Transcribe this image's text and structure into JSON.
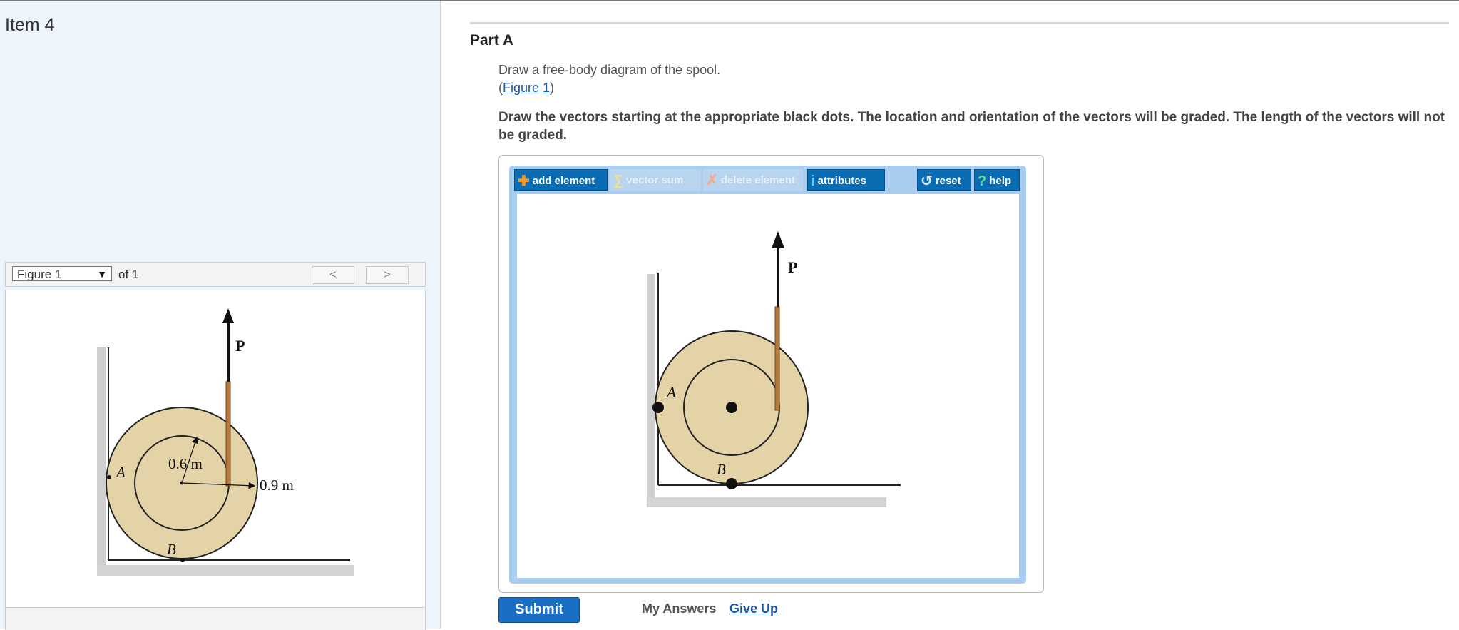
{
  "left": {
    "item_title": "Item 4",
    "figure_select": "Figure 1",
    "figure_of": "of 1",
    "prev_label": "<",
    "next_label": ">"
  },
  "figure": {
    "force_label": "P",
    "point_a": "A",
    "point_b": "B",
    "inner_radius": "0.6 m",
    "outer_radius": "0.9 m"
  },
  "main": {
    "part_title": "Part A",
    "instruction": "Draw a free-body diagram of the spool.",
    "figure_link_open": "(",
    "figure_link": "Figure 1",
    "figure_link_close": ")",
    "bold_instruction": "Draw the vectors starting at the appropriate black dots. The location and orientation of the vectors will be graded. The length of the vectors will not be graded."
  },
  "toolbar": {
    "add_element": "add element",
    "vector_sum": "vector sum",
    "delete_element": "delete element",
    "attributes": "attributes",
    "reset": "reset",
    "help": "help"
  },
  "canvas": {
    "force_label": "P",
    "point_a": "A",
    "point_b": "B"
  },
  "actions": {
    "submit": "Submit",
    "my_answers": "My Answers",
    "give_up": "Give Up"
  },
  "colors": {
    "spool": "#e3d3a6",
    "rope": "#b5793c",
    "accent": "#0a6db3"
  }
}
